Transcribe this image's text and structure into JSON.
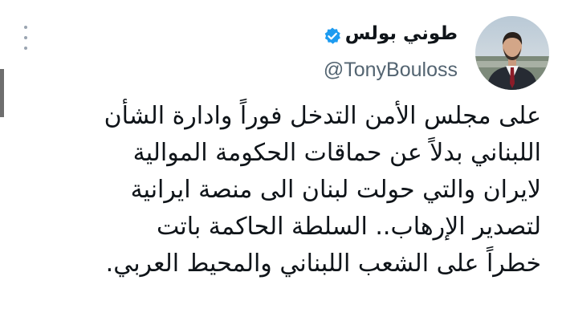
{
  "author": {
    "display_name": "طوني بولس",
    "handle": "@TonyBouloss",
    "verified": true,
    "avatar_icon": "profile-photo"
  },
  "icons": {
    "more": "more-vertical-icon",
    "verified": "verified-badge-icon"
  },
  "colors": {
    "verified_blue": "#1d9bf0",
    "text": "#0f1419",
    "secondary_text": "#536471",
    "more_icon": "#9aa5b1"
  },
  "tweet": {
    "lines": [
      "على مجلس الأمن التدخل فوراً وادارة الشأن",
      "اللبناني بدلاً عن حماقات الحكومة الموالية",
      "لايران والتي حولت لبنان الى منصة ايرانية",
      "لتصدير الإرهاب.. السلطة الحاكمة باتت",
      "خطراً على الشعب اللبناني والمحيط العربي."
    ]
  }
}
